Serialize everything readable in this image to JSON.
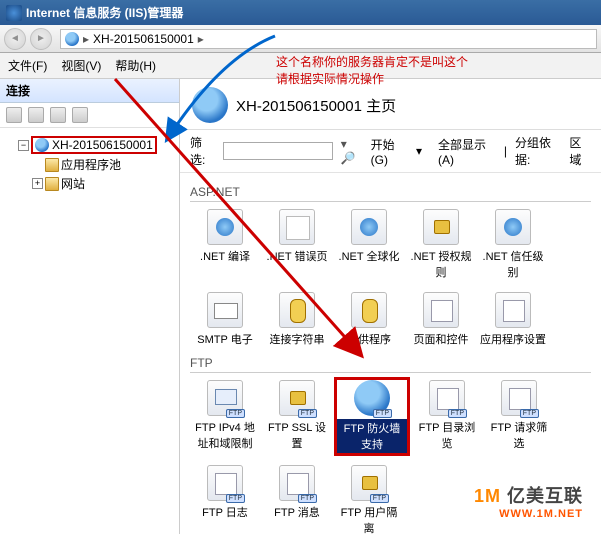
{
  "window": {
    "title": "Internet 信息服务 (IIS)管理器"
  },
  "breadcrumb": {
    "node": "XH-201506150001"
  },
  "menu": {
    "file": "文件(F)",
    "view": "视图(V)",
    "help": "帮助(H)"
  },
  "annotation": {
    "line1": "这个名称你的服务器肯定不是叫这个",
    "line2": "请根据实际情况操作"
  },
  "left": {
    "header": "连接",
    "nodes": {
      "server": "XH-201506150001",
      "app_pools": "应用程序池",
      "sites": "网站"
    }
  },
  "page": {
    "title": "XH-201506150001 主页",
    "filter_label": "筛选:",
    "start_label": "开始(G)",
    "showall_label": "全部显示(A)",
    "groupby_label": "分组依据:",
    "area_label": "区域"
  },
  "groups": {
    "aspnet": "ASP.NET",
    "ftp": "FTP"
  },
  "aspnet_items": [
    {
      "label": ".NET 编译"
    },
    {
      "label": ".NET 错误页"
    },
    {
      "label": ".NET 全球化"
    },
    {
      "label": ".NET 授权规则"
    },
    {
      "label": ".NET 信任级别"
    },
    {
      "label": "SMTP 电子"
    },
    {
      "label": "连接字符串"
    },
    {
      "label": "提供程序"
    },
    {
      "label": "页面和控件"
    },
    {
      "label": "应用程序设置"
    }
  ],
  "ftp_items": [
    {
      "label": "FTP IPv4 地址和域限制",
      "badge": "FTP"
    },
    {
      "label": "FTP SSL 设置",
      "badge": "FTP"
    },
    {
      "label": "FTP 防火墙支持",
      "badge": "FTP",
      "selected": true
    },
    {
      "label": "FTP 目录浏览",
      "badge": "FTP"
    },
    {
      "label": "FTP 请求筛选",
      "badge": "FTP"
    },
    {
      "label": "FTP 日志",
      "badge": "FTP"
    },
    {
      "label": "FTP 消息",
      "badge": "FTP"
    },
    {
      "label": "FTP 用户隔离",
      "badge": "FTP"
    }
  ],
  "watermark": {
    "brand_cn": "亿美互联",
    "url": "WWW.1M.NET"
  }
}
